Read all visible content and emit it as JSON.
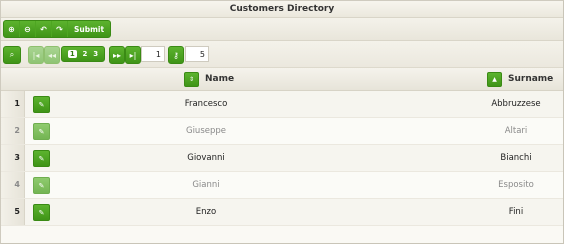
{
  "title": "Customers Directory",
  "toolbar": {
    "add_icon": "add-icon",
    "remove_icon": "remove-icon",
    "undo_icon": "undo-icon",
    "redo_icon": "redo-icon",
    "submit_label": "Submit"
  },
  "pager": {
    "pages": [
      "1",
      "2",
      "3"
    ],
    "current_page": "1",
    "page_input": "1",
    "page_size": "5"
  },
  "columns": {
    "name": "Name",
    "surname": "Surname"
  },
  "rows": [
    {
      "num": "1",
      "name": "Francesco",
      "surname": "Abbruzzese"
    },
    {
      "num": "2",
      "name": "Giuseppe",
      "surname": "Altari"
    },
    {
      "num": "3",
      "name": "Giovanni",
      "surname": "Bianchi"
    },
    {
      "num": "4",
      "name": "Gianni",
      "surname": "Esposito"
    },
    {
      "num": "5",
      "name": "Enzo",
      "surname": "Fini"
    }
  ]
}
